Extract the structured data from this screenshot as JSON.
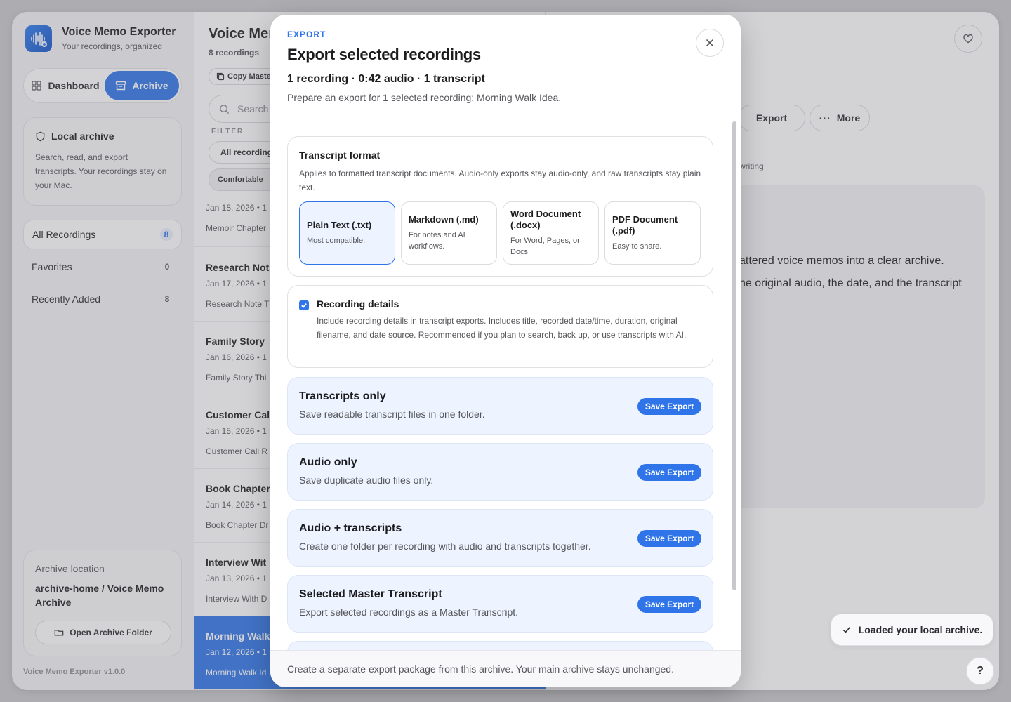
{
  "app": {
    "title": "Voice Memo Exporter",
    "subtitle": "Your recordings, organized",
    "version": "Voice Memo Exporter v1.0.0"
  },
  "sidebar": {
    "segments": [
      {
        "label": "Dashboard",
        "icon": "grid-icon",
        "active": false
      },
      {
        "label": "Archive",
        "icon": "archive-box-icon",
        "active": true
      }
    ],
    "info": {
      "title": "Local archive",
      "body": "Search, read, and export transcripts. Your recordings stay on your Mac."
    },
    "nav": [
      {
        "label": "All Recordings",
        "count": "8",
        "selected": true
      },
      {
        "label": "Favorites",
        "count": "0",
        "selected": false
      },
      {
        "label": "Recently Added",
        "count": "8",
        "selected": false
      }
    ],
    "location": {
      "label": "Archive location",
      "value": "archive-home / Voice Memo Archive",
      "button": "Open Archive Folder"
    }
  },
  "list": {
    "title": "Voice Mer",
    "count": "8 recordings",
    "copy_button": "Copy Maste",
    "search_placeholder": "Search",
    "filter_label": "FILTER",
    "filter_value": "All recording",
    "density": "Comfortable",
    "rows": [
      {
        "title": "",
        "date": "Jan 18, 2026 • 1",
        "preview": "Memoir Chapter"
      },
      {
        "title": "Research Not",
        "date": "Jan 17, 2026 • 1",
        "preview": "Research Note T"
      },
      {
        "title": "Family Story",
        "date": "Jan 16, 2026 • 1",
        "preview": "Family Story Thi"
      },
      {
        "title": "Customer Cal",
        "date": "Jan 15, 2026 • 1",
        "preview": "Customer Call R"
      },
      {
        "title": "Book Chapter",
        "date": "Jan 14, 2026 • 1",
        "preview": "Book Chapter Dr"
      },
      {
        "title": "Interview Wit",
        "date": "Jan 13, 2026 • 1",
        "preview": "Interview With D"
      },
      {
        "title": "Morning Walk",
        "date": "Jan 12, 2026 • 1",
        "preview": "Morning Walk Id"
      }
    ]
  },
  "detail": {
    "export_label": "Export",
    "more_label": "More",
    "tag": "writing",
    "body_line1": "attered voice memos into a clear archive.",
    "body_line2": "he original audio, the date, and the transcript"
  },
  "toast": "Loaded your local archive.",
  "help": "?",
  "modal": {
    "eyebrow": "EXPORT",
    "title": "Export selected recordings",
    "stats": "1 recording · 0:42 audio · 1 transcript",
    "description": "Prepare an export for 1 selected recording: Morning Walk Idea.",
    "format": {
      "title": "Transcript format",
      "desc": "Applies to formatted transcript documents. Audio-only exports stay audio-only, and raw transcripts stay plain text.",
      "options": [
        {
          "name": "Plain Text (.txt)",
          "desc": "Most compatible.",
          "selected": true
        },
        {
          "name": "Markdown (.md)",
          "desc": "For notes and AI workflows.",
          "selected": false
        },
        {
          "name": "Word Document (.docx)",
          "desc": "For Word, Pages, or Docs.",
          "selected": false
        },
        {
          "name": "PDF Document (.pdf)",
          "desc": "Easy to share.",
          "selected": false
        }
      ]
    },
    "details": {
      "checked": true,
      "title": "Recording details",
      "desc": "Include recording details in transcript exports. Includes title, recorded date/time, duration, original filename, and date source. Recommended if you plan to search, back up, or use transcripts with AI."
    },
    "exports": [
      {
        "title": "Transcripts only",
        "desc": "Save readable transcript files in one folder.",
        "button": "Save Export"
      },
      {
        "title": "Audio only",
        "desc": "Save duplicate audio files only.",
        "button": "Save Export"
      },
      {
        "title": "Audio + transcripts",
        "desc": "Create one folder per recording with audio and transcripts together.",
        "button": "Save Export"
      },
      {
        "title": "Selected Master Transcript",
        "desc": "Export selected recordings as a Master Transcript.",
        "button": "Save Export"
      }
    ],
    "footer": "Create a separate export package from this archive. Your main archive stays unchanged."
  },
  "colors": {
    "accent": "#2f74e8",
    "accent_soft": "#eef4ff",
    "text": "#1d1d1f",
    "muted": "#55555a"
  }
}
